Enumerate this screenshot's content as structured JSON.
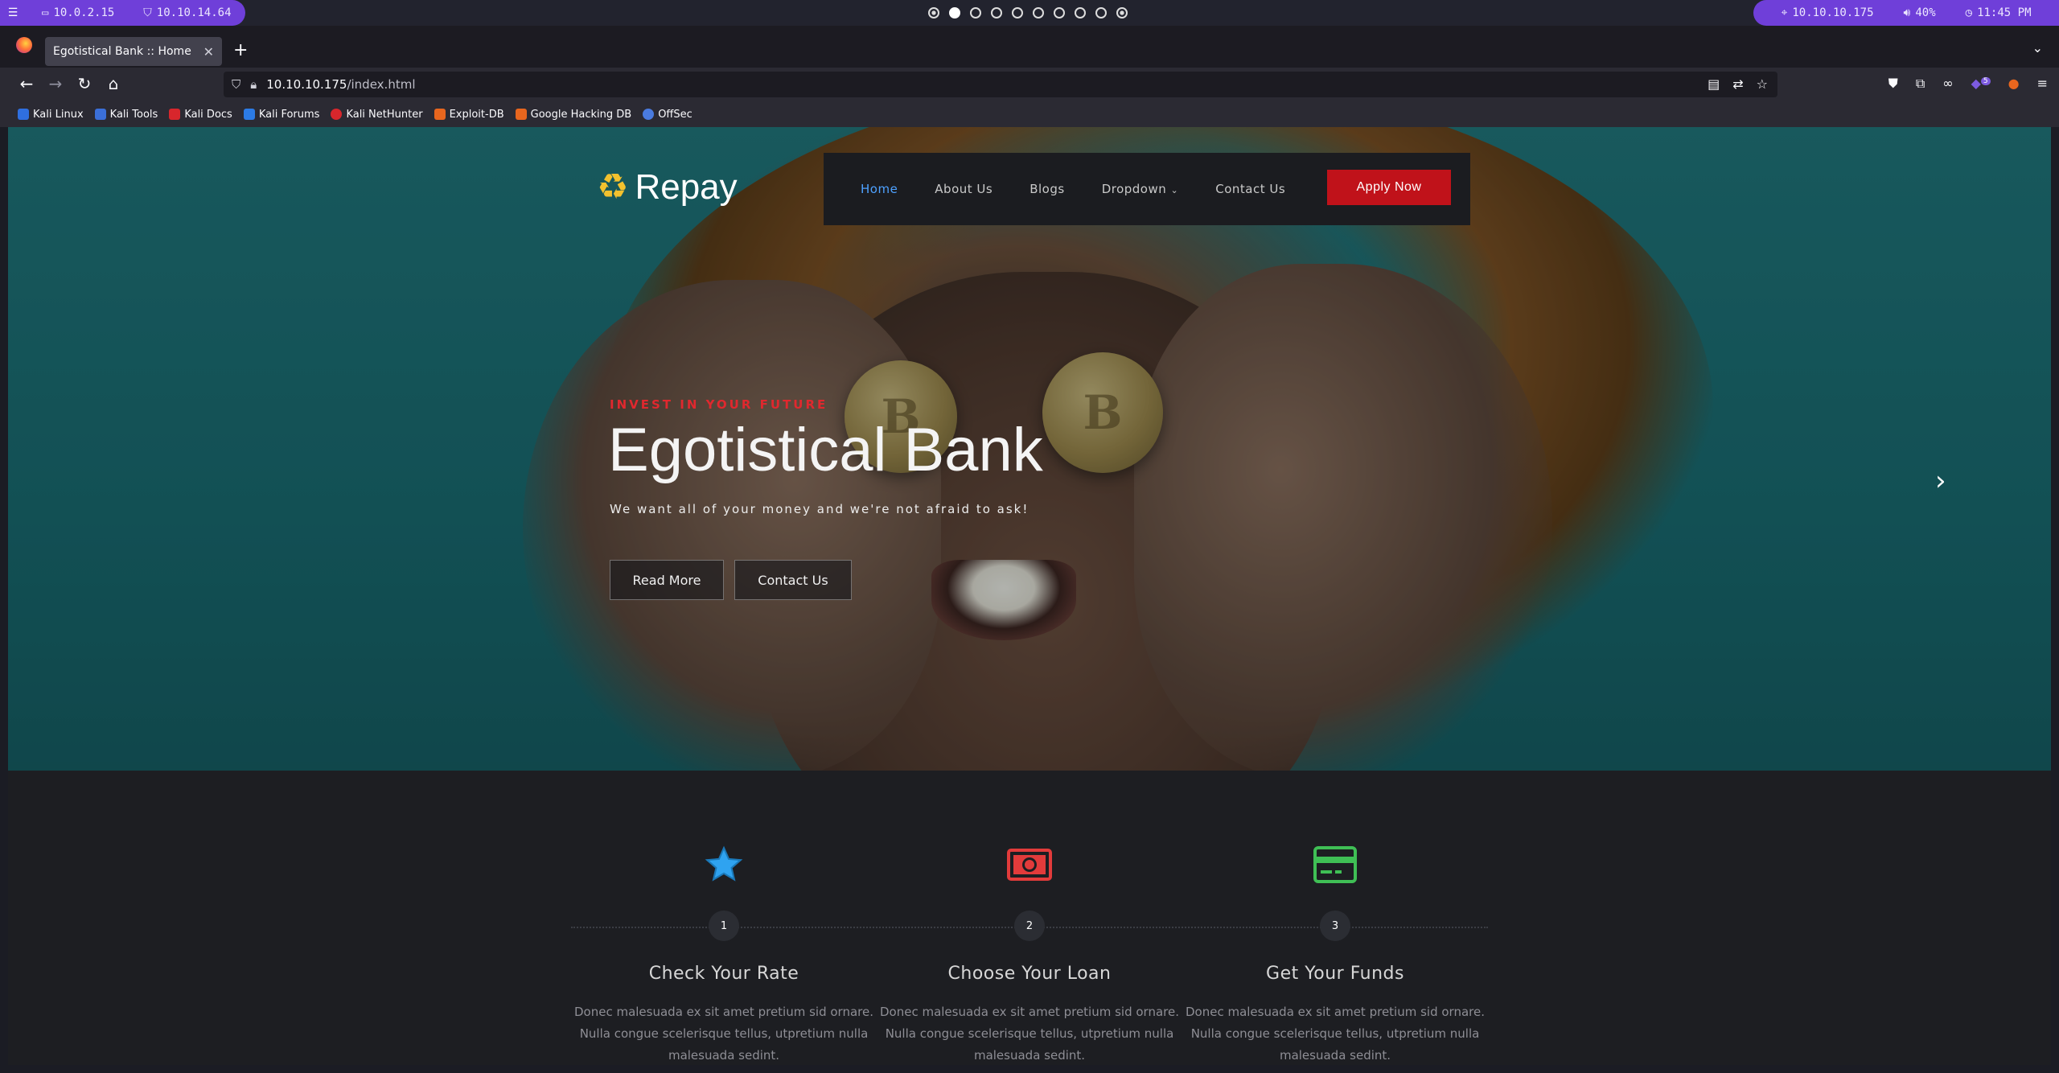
{
  "system_bar": {
    "left_items": [
      {
        "label": "10.0.2.15",
        "icon": "monitor-icon"
      },
      {
        "label": "10.10.14.64",
        "icon": "shield-icon"
      }
    ],
    "right_items": [
      {
        "label": "10.10.10.175",
        "icon": "target-icon"
      },
      {
        "label": "40%",
        "icon": "volume-icon"
      },
      {
        "label": "11:45 PM",
        "icon": "clock-icon"
      }
    ],
    "workspaces": 10,
    "active_workspace": 2,
    "accent": "#6f3fd9"
  },
  "browser": {
    "tab_title": "Egotistical Bank :: Home",
    "url_host": "10.10.10.175",
    "url_path": "/index.html",
    "bookmarks": [
      {
        "label": "Kali Linux",
        "color": "#2f6fe0"
      },
      {
        "label": "Kali Tools",
        "color": "#3b6fd8"
      },
      {
        "label": "Kali Docs",
        "color": "#d8262c"
      },
      {
        "label": "Kali Forums",
        "color": "#2c7be5"
      },
      {
        "label": "Kali NetHunter",
        "color": "#d8262c"
      },
      {
        "label": "Exploit-DB",
        "color": "#e8661e"
      },
      {
        "label": "Google Hacking DB",
        "color": "#e8661e"
      },
      {
        "label": "OffSec",
        "color": "#4a7be0"
      }
    ],
    "extension_badges": [
      "5"
    ]
  },
  "site": {
    "logo": "Repay",
    "nav": [
      "Home",
      "About Us",
      "Blogs",
      "Dropdown",
      "Contact Us"
    ],
    "nav_active": "Home",
    "apply_label": "Apply Now",
    "hero": {
      "kicker": "INVEST IN YOUR FUTURE",
      "title": "Egotistical Bank",
      "subtitle": "We want all of your money and we're not afraid to ask!",
      "read_more": "Read More",
      "contact": "Contact Us"
    },
    "steps": [
      {
        "num": "1",
        "title": "Check Your Rate",
        "icon": "star-icon",
        "color": "#2fa3f0",
        "text": "Donec malesuada ex sit amet pretium sid ornare. Nulla congue scelerisque tellus, utpretium nulla malesuada sedint."
      },
      {
        "num": "2",
        "title": "Choose Your Loan",
        "icon": "money-icon",
        "color": "#e23b3b",
        "text": "Donec malesuada ex sit amet pretium sid ornare. Nulla congue scelerisque tellus, utpretium nulla malesuada sedint."
      },
      {
        "num": "3",
        "title": "Get Your Funds",
        "icon": "credit-card-icon",
        "color": "#3fbf55",
        "text": "Donec malesuada ex sit amet pretium sid ornare. Nulla congue scelerisque tellus, utpretium nulla malesuada sedint."
      }
    ]
  }
}
